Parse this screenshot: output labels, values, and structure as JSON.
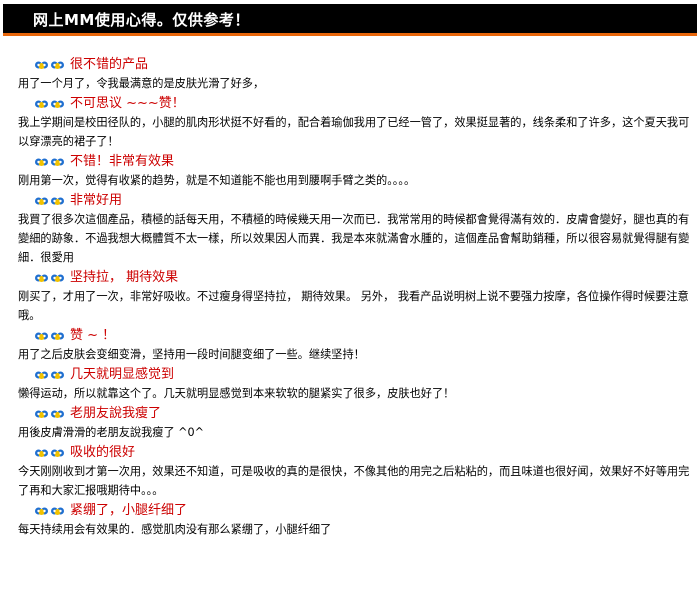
{
  "header": {
    "title": "网上MM使用心得。仅供参考！"
  },
  "colors": {
    "accent": "#e8660a",
    "title_red": "#cc0000",
    "header_bg": "#000000"
  },
  "reviews": [
    {
      "title": "很不错的产品",
      "body": "用了一个月了，令我最满意的是皮肤光滑了好多，"
    },
    {
      "title": "不可思议 ~~~赞！",
      "body": "我上学期间是校田径队的，小腿的肌肉形状挺不好看的，配合着瑜伽我用了已经一管了，效果挺显著的，线条柔和了许多，这个夏天我可以穿漂亮的裙子了！"
    },
    {
      "title": "不错！非常有效果",
      "body": "刚用第一次，觉得有收紧的趋势，就是不知道能不能也用到腰啊手臂之类的。。。。"
    },
    {
      "title": "非常好用",
      "body": "我買了很多次這個產品，積極的話每天用，不積極的時候幾天用一次而已．我常常用的時候都會覺得滿有效的．皮膚會變好，腿也真的有變細的跡象．不過我想大概體質不太一樣，所以效果因人而異．我是本來就滿會水腫的，這個產品會幫助銷種，所以很容易就覺得腿有變細．很愛用"
    },
    {
      "title": "坚持拉，  期待效果",
      "body": "刚买了，才用了一次，非常好吸收。不过瘦身得坚持拉，  期待效果。  另外，  我看产品说明树上说不要强力按摩，各位操作得时候要注意哦。"
    },
    {
      "title": "赞 ~ ！",
      "body": "用了之后皮肤会变细变滑，坚持用一段时间腿变细了一些。继续坚持！"
    },
    {
      "title": "几天就明显感觉到",
      "body": "懒得运动，所以就靠这个了。几天就明显感觉到本来软软的腿紧实了很多，皮肤也好了！"
    },
    {
      "title": "老朋友說我瘦了",
      "body": "用後皮膚滑滑的老朋友說我瘦了 ^0^"
    },
    {
      "title": "吸收的很好",
      "body": "今天刚刚收到才第一次用，效果还不知道，可是吸收的真的是很快，不像其他的用完之后粘粘的，而且味道也很好闻，效果好不好等用完了再和大家汇报哦期待中。。。"
    },
    {
      "title": "紧绷了，小腿纤细了",
      "body": "每天持续用会有效果的．感觉肌肉没有那么紧绷了，小腿纤细了"
    }
  ]
}
